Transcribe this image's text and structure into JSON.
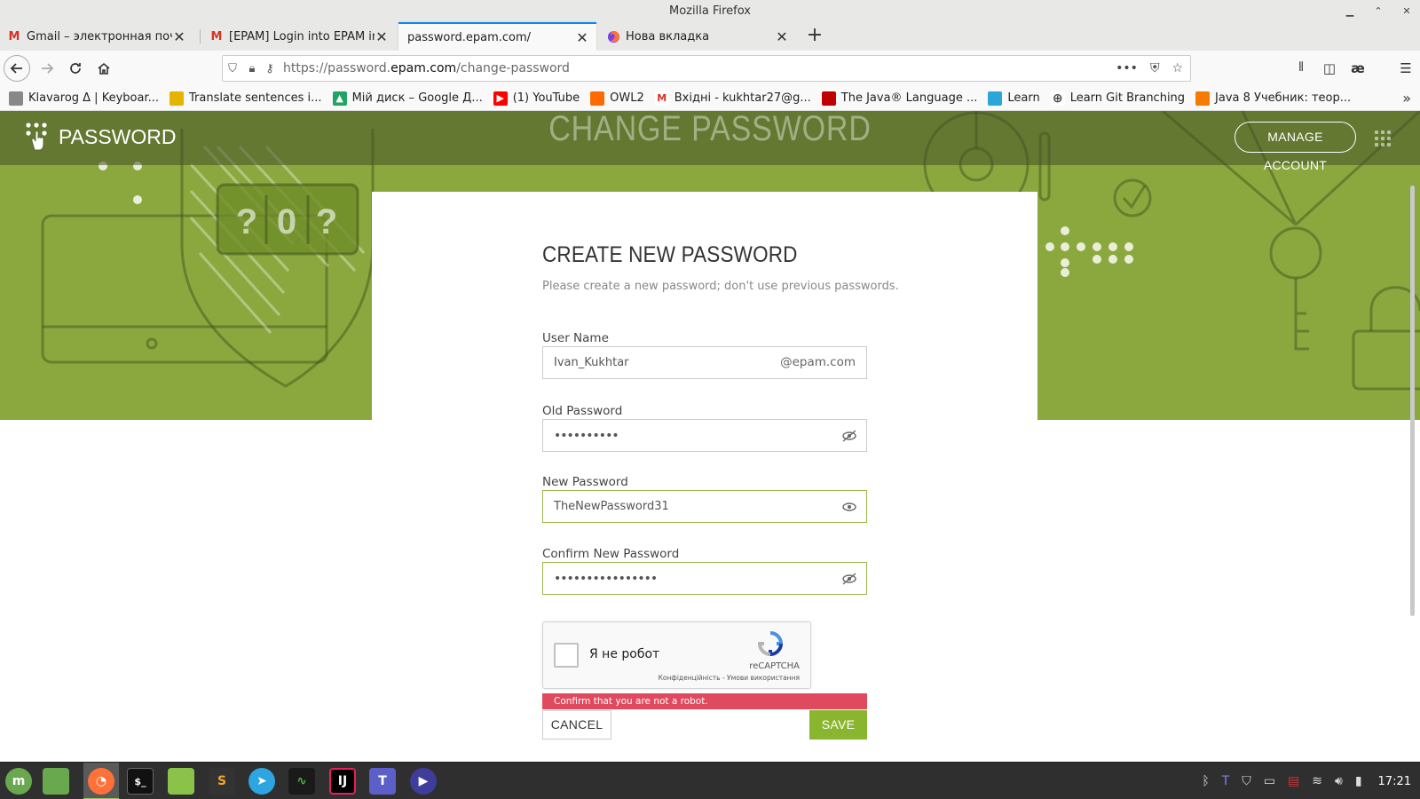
{
  "window": {
    "title": "Mozilla Firefox"
  },
  "tabs": [
    {
      "label": "Gmail – электронная почта",
      "icon": "gmail-icon"
    },
    {
      "label": "[EPAM] Login into EPAM info",
      "icon": "gmail-icon"
    },
    {
      "label": "password.epam.com/",
      "icon": "none",
      "active": true
    },
    {
      "label": "Нова вкладка",
      "icon": "firefox-icon"
    }
  ],
  "urlbar": {
    "prefix": "https://password.",
    "domain": "epam.com",
    "path": "/change-password"
  },
  "bookmarks": [
    {
      "label": "Klavarog Δ | Keyboar...",
      "color": "#888888",
      "glyph": ""
    },
    {
      "label": "Translate sentences i...",
      "color": "#e6b400",
      "glyph": ""
    },
    {
      "label": "Мій диск – Google Д...",
      "color": "#1fa463",
      "glyph": "▲"
    },
    {
      "label": "(1) YouTube",
      "color": "#ff0000",
      "glyph": "▶"
    },
    {
      "label": "OWL2",
      "color": "#ff6a00",
      "glyph": ""
    },
    {
      "label": "Вхідні - kukhtar27@g...",
      "color": "#d93025",
      "glyph": "M"
    },
    {
      "label": "The Java® Language ...",
      "color": "#c00000",
      "glyph": ""
    },
    {
      "label": "Learn",
      "color": "#2aa7d6",
      "glyph": ""
    },
    {
      "label": "Learn Git Branching",
      "color": "#444444",
      "glyph": "⊕"
    },
    {
      "label": "Java 8 Учебник: теор...",
      "color": "#f57c00",
      "glyph": ""
    }
  ],
  "site": {
    "logo_text": "PASSWORD",
    "page_heading": "CHANGE PASSWORD",
    "manage_account": "MANAGE ACCOUNT",
    "hero_code": [
      "?",
      "0",
      "?"
    ]
  },
  "form": {
    "title": "CREATE NEW PASSWORD",
    "subtitle": "Please create a new password; don't use previous passwords.",
    "username_label": "User Name",
    "username_value": "Ivan_Kukhtar",
    "username_suffix": "@epam.com",
    "old_password_label": "Old Password",
    "old_password_value": "••••••••••",
    "new_password_label": "New Password",
    "new_password_value": "TheNewPassword31",
    "confirm_label": "Confirm New Password",
    "confirm_value": "••••••••••••••••",
    "captcha_label": "Я не робот",
    "captcha_brand": "reCAPTCHA",
    "captcha_links": "Конфіденційність - Умови використання",
    "error": "Confirm that you are not a robot.",
    "cancel": "CANCEL",
    "save": "SAVE"
  },
  "taskbar": {
    "time": "17:21"
  },
  "colors": {
    "hero_green": "#8ba83e",
    "save_green": "#8ab52e",
    "error_red": "#e04a5f",
    "tab_accent": "#0a84ff"
  }
}
